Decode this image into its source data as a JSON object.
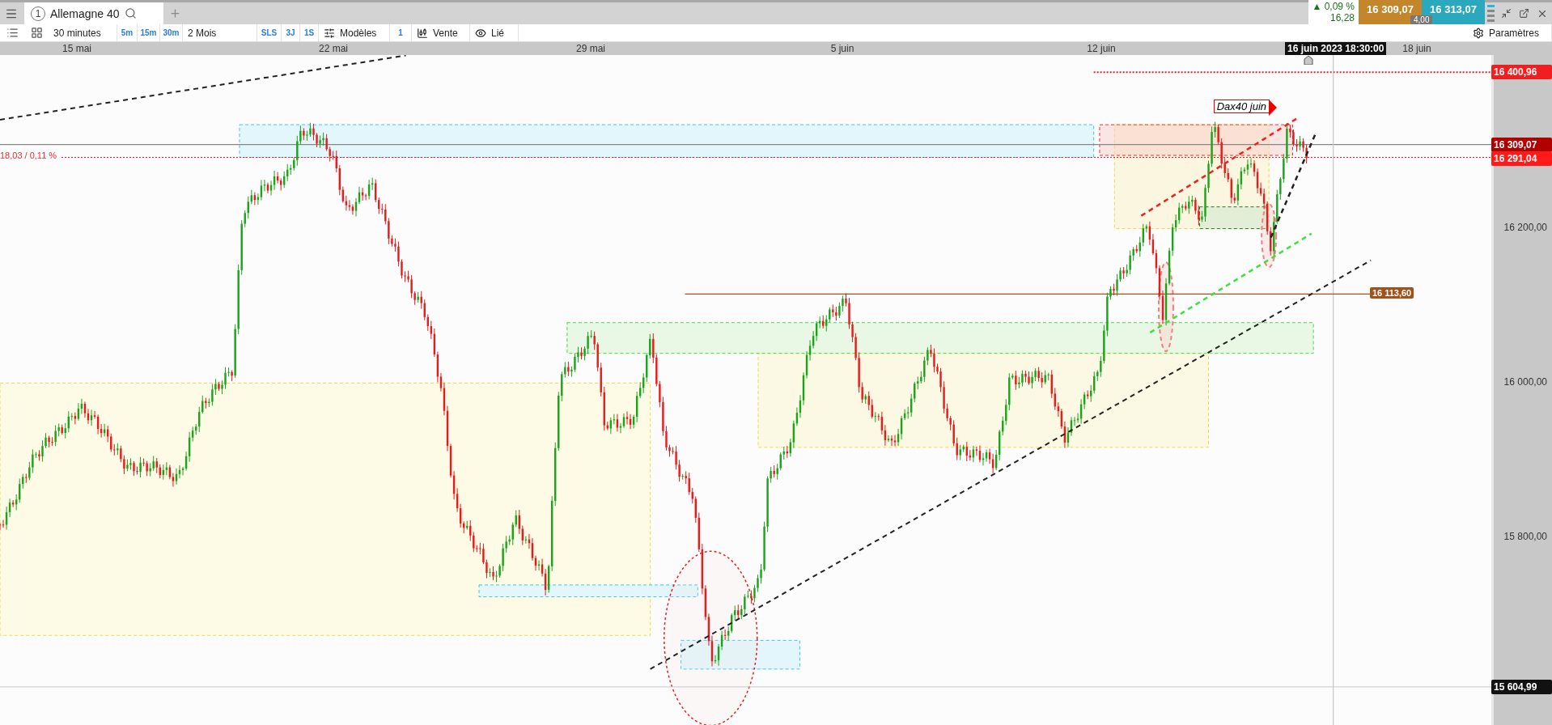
{
  "tab": {
    "number": "1",
    "title": "Allemagne 40"
  },
  "toolbar": {
    "interval": "30 minutes",
    "quick_intervals": [
      "5m",
      "15m",
      "30m"
    ],
    "range": "2 Mois",
    "presets": [
      "SLS",
      "3J",
      "1S"
    ],
    "templates": "Modèles",
    "count": "1",
    "mode": "Vente",
    "link": "Lié",
    "settings": "Paramètres"
  },
  "quote": {
    "change_arrow": "▲",
    "change_pct": "0,09 %",
    "change": "16,28",
    "sell": "16 309,07",
    "buy": "16 313,07",
    "spread": "4,00"
  },
  "time_axis": {
    "labels": [
      "15 mai",
      "22 mai",
      "29 mai",
      "5 juin",
      "12 juin",
      "18 juin"
    ],
    "cursor": "16 juin 2023 18:30:00"
  },
  "price_axis": {
    "ticks": [
      "16 200,00",
      "16 000,00",
      "15 800,00"
    ],
    "markers": [
      {
        "kind": "alert",
        "text": "16 400,96"
      },
      {
        "kind": "current",
        "text": "16 309,07"
      },
      {
        "kind": "bid",
        "text": "16 291,04"
      },
      {
        "kind": "low",
        "text": "15 604,99"
      }
    ]
  },
  "annotations": {
    "change_label": "18,03 / 0,11 %",
    "level_label": "16 113,60",
    "note": "Dax40 juin"
  }
}
